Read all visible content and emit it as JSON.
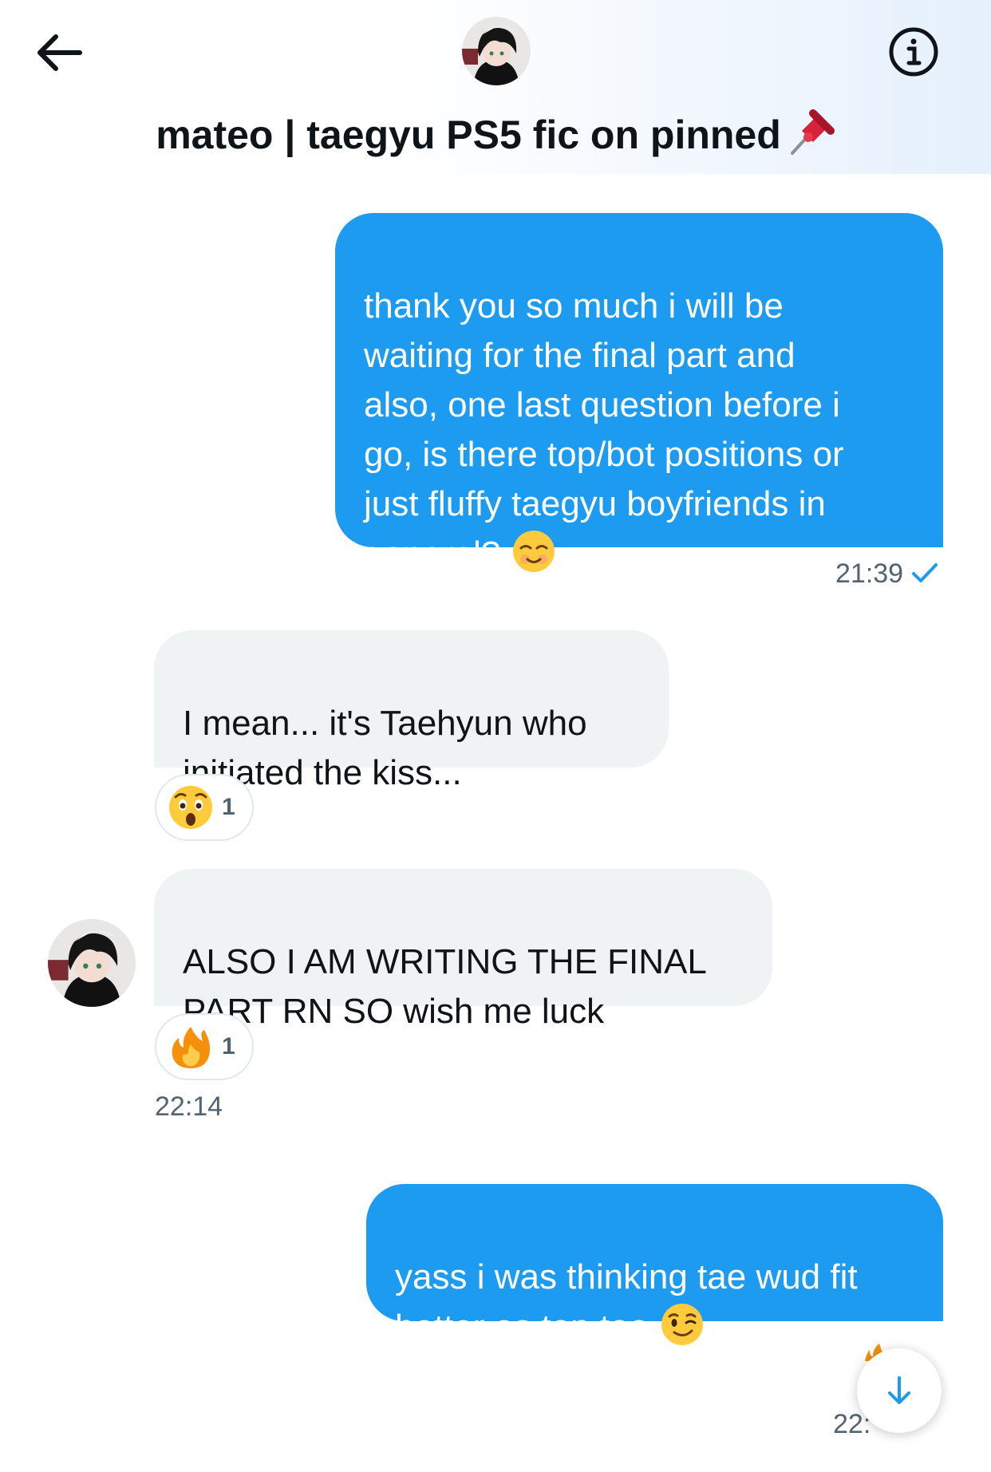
{
  "header": {
    "title": "mateo | taegyu PS5 fic on pinned",
    "back_icon": "arrow-left-icon",
    "info_icon": "info-circle-icon",
    "title_emoji": "pushpin-emoji"
  },
  "messages": [
    {
      "direction": "outgoing",
      "text": "thank you so much i will be\nwaiting for the final part and\nalso, one last question before i\ngo, is there top/bot positions or\njust fluffy taegyu boyfriends in\ngeneral?",
      "emoji": "smiling-face-emoji",
      "time": "21:39",
      "status": "read-check"
    },
    {
      "direction": "incoming",
      "text": "I mean... it's Taehyun who\ninitiated the kiss...",
      "reaction": {
        "emoji": "astonished-face-emoji",
        "count": "1"
      }
    },
    {
      "direction": "incoming",
      "text": "ALSO I AM WRITING THE FINAL\nPART RN SO wish me luck",
      "reaction": {
        "emoji": "fire-emoji",
        "count": "1"
      },
      "time": "22:14"
    },
    {
      "direction": "outgoing",
      "text": "yass i was thinking tae wud fit\nbetter as top too",
      "emoji": "winking-face-emoji",
      "time": "22:"
    }
  ],
  "scroll_button": {
    "icon": "arrow-down-icon"
  },
  "colors": {
    "outgoing_bubble": "#1d9bf0",
    "incoming_bubble": "#eff3f4",
    "meta_text": "#536471",
    "accent": "#1d9bf0"
  }
}
